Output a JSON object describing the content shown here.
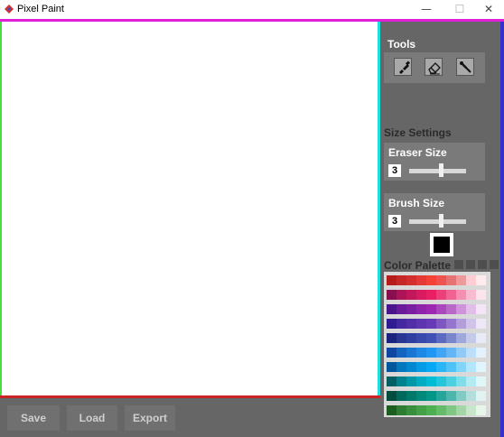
{
  "window": {
    "title": "Pixel Paint",
    "minimize": "—",
    "maximize": "☐",
    "close": "✕"
  },
  "colors": {
    "magenta_bar": "#e020d8",
    "canvas_left_edge": "#44dd44",
    "canvas_right_edge": "#22dddd",
    "canvas_bottom_edge": "#cc2222",
    "right_edge": "#3333cc",
    "selected_color": "#000000"
  },
  "tools": {
    "title": "Tools",
    "items": [
      {
        "name": "brush",
        "icon": "brush-icon"
      },
      {
        "name": "eraser",
        "icon": "eraser-icon"
      },
      {
        "name": "eyedropper",
        "icon": "eyedropper-icon"
      }
    ]
  },
  "size_settings": {
    "title": "Size Settings",
    "eraser": {
      "label": "Eraser Size",
      "value": "3",
      "slider_fraction": 0.55
    },
    "brush": {
      "label": "Brush Size",
      "value": "3",
      "slider_fraction": 0.55
    }
  },
  "color_palette": {
    "title": "Color Palette",
    "rows": [
      [
        "#b71c1c",
        "#c62828",
        "#d32f2f",
        "#e53935",
        "#f44336",
        "#ef5350",
        "#e57373",
        "#ef9a9a",
        "#ffcdd2",
        "#ffebee"
      ],
      [
        "#880e4f",
        "#ad1457",
        "#c2185b",
        "#d81b60",
        "#e91e63",
        "#ec407a",
        "#f06292",
        "#f48fb1",
        "#f8bbd0",
        "#fce4ec"
      ],
      [
        "#4a148c",
        "#6a1b9a",
        "#7b1fa2",
        "#8e24aa",
        "#9c27b0",
        "#ab47bc",
        "#ba68c8",
        "#ce93d8",
        "#e1bee7",
        "#f3e5f5"
      ],
      [
        "#311b92",
        "#4527a0",
        "#512da8",
        "#5e35b1",
        "#673ab7",
        "#7e57c2",
        "#9575cd",
        "#b39ddb",
        "#d1c4e9",
        "#ede7f6"
      ],
      [
        "#1a237e",
        "#283593",
        "#303f9f",
        "#3949ab",
        "#3f51b5",
        "#5c6bc0",
        "#7986cb",
        "#9fa8da",
        "#c5cae9",
        "#e8eaf6"
      ],
      [
        "#0d47a1",
        "#1565c0",
        "#1976d2",
        "#1e88e5",
        "#2196f3",
        "#42a5f5",
        "#64b5f6",
        "#90caf9",
        "#bbdefb",
        "#e3f2fd"
      ],
      [
        "#01579b",
        "#0277bd",
        "#0288d1",
        "#039be5",
        "#03a9f4",
        "#29b6f6",
        "#4fc3f7",
        "#81d4fa",
        "#b3e5fc",
        "#e1f5fe"
      ],
      [
        "#006064",
        "#00838f",
        "#0097a7",
        "#00acc1",
        "#00bcd4",
        "#26c6da",
        "#4dd0e1",
        "#80deea",
        "#b2ebf2",
        "#e0f7fa"
      ],
      [
        "#004d40",
        "#00695c",
        "#00796b",
        "#00897b",
        "#009688",
        "#26a69a",
        "#4db6ac",
        "#80cbc4",
        "#b2dfdb",
        "#e0f2f1"
      ],
      [
        "#1b5e20",
        "#2e7d32",
        "#388e3c",
        "#43a047",
        "#4caf50",
        "#66bb6a",
        "#81c784",
        "#a5d6a7",
        "#c8e6c9",
        "#e8f5e9"
      ]
    ]
  },
  "bottom_bar": {
    "save": "Save",
    "load": "Load",
    "export": "Export"
  }
}
